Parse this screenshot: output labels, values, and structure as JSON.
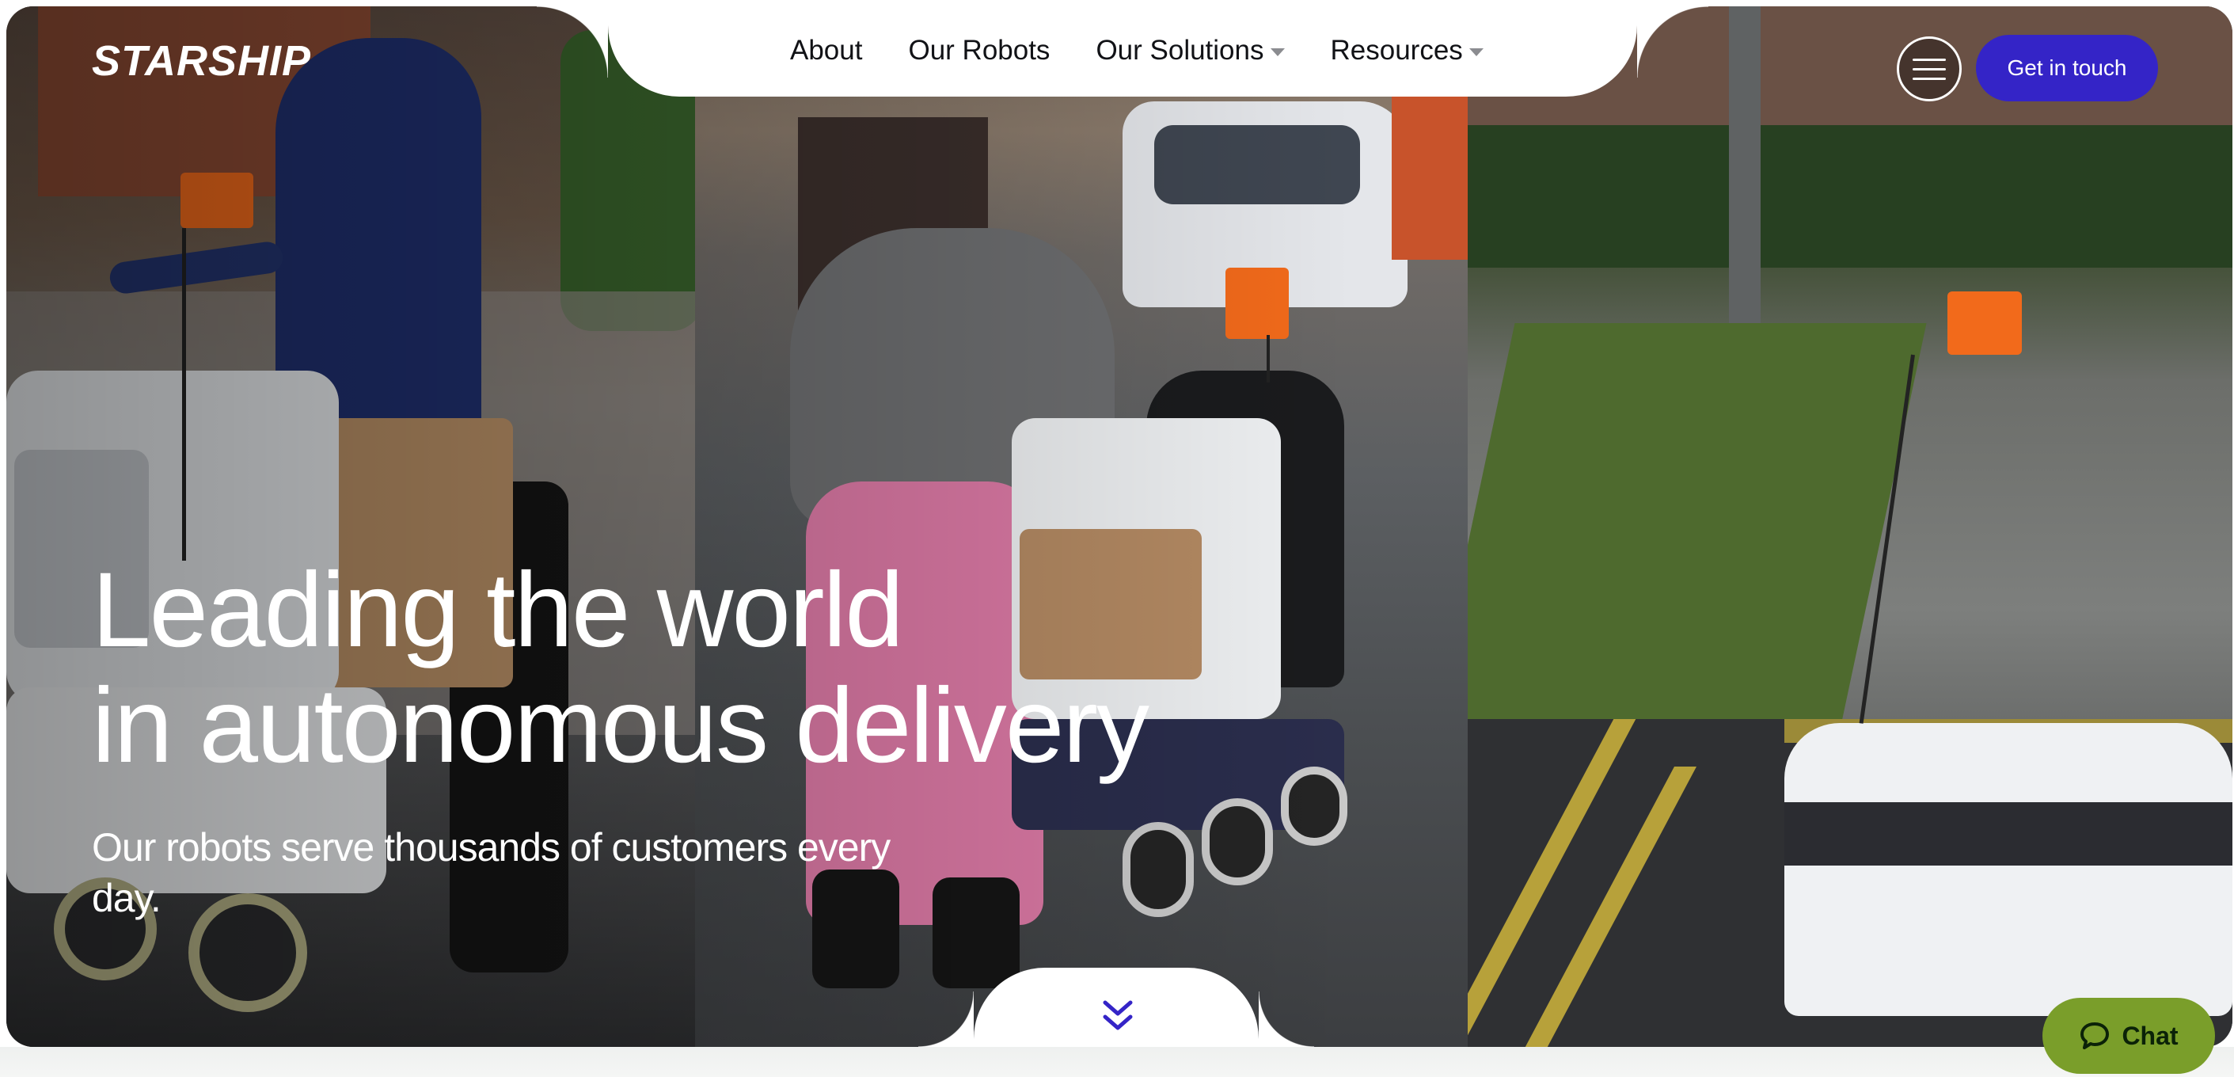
{
  "brand": {
    "logo_text": "STARSHIP"
  },
  "nav": {
    "links": [
      {
        "label": "About",
        "has_dropdown": false
      },
      {
        "label": "Our Robots",
        "has_dropdown": false
      },
      {
        "label": "Our Solutions",
        "has_dropdown": true
      },
      {
        "label": "Resources",
        "has_dropdown": true
      }
    ],
    "menu_icon": "hamburger-icon",
    "cta_label": "Get in touch"
  },
  "hero": {
    "title_line_1": "Leading the world",
    "title_line_2": "in autonomous delivery",
    "subtitle": "Our robots serve thousands of customers every day.",
    "scroll_icon": "double-chevron-down-icon"
  },
  "chat": {
    "label": "Chat",
    "icon": "chat-bubble-icon"
  },
  "colors": {
    "cta_background": "#3424c7",
    "chat_background": "#7a9e2a",
    "robot_flag": "#f26a1b",
    "scroll_chevron": "#3424c7"
  }
}
